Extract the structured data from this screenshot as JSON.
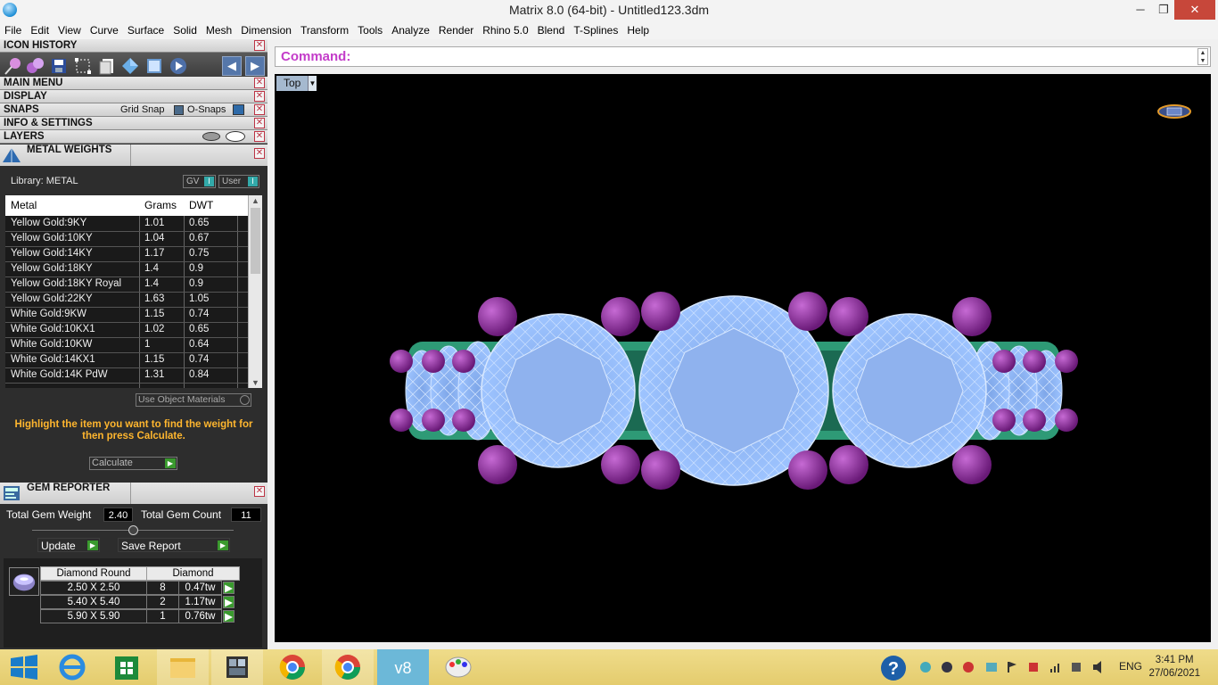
{
  "window": {
    "title": "Matrix 8.0 (64-bit) - Untitled123.3dm",
    "minimize": "─",
    "maximize": "❐",
    "close": "✕"
  },
  "menu": [
    "File",
    "Edit",
    "View",
    "Curve",
    "Surface",
    "Solid",
    "Mesh",
    "Dimension",
    "Transform",
    "Tools",
    "Analyze",
    "Render",
    "Rhino 5.0",
    "Blend",
    "T-Splines",
    "Help"
  ],
  "sections": {
    "icon_history": "ICON HISTORY",
    "main_menu": "MAIN MENU",
    "display": "DISPLAY",
    "snaps": "SNAPS",
    "grid_snap": "Grid Snap",
    "o_snaps": "O-Snaps",
    "info_settings": "INFO & SETTINGS",
    "layers": "LAYERS"
  },
  "metal_weights": {
    "title": "METAL WEIGHTS",
    "library": "Library: METAL",
    "gv_toggle": "GV",
    "user_toggle": "User",
    "columns": [
      "Metal",
      "Grams",
      "DWT"
    ],
    "rows": [
      [
        "Yellow Gold:9KY",
        "1.01",
        "0.65"
      ],
      [
        "Yellow Gold:10KY",
        "1.04",
        "0.67"
      ],
      [
        "Yellow Gold:14KY",
        "1.17",
        "0.75"
      ],
      [
        "Yellow Gold:18KY",
        "1.4",
        "0.9"
      ],
      [
        "Yellow Gold:18KY Royal",
        "1.4",
        "0.9"
      ],
      [
        "Yellow Gold:22KY",
        "1.63",
        "1.05"
      ],
      [
        "White Gold:9KW",
        "1.15",
        "0.74"
      ],
      [
        "White Gold:10KX1",
        "1.02",
        "0.65"
      ],
      [
        "White Gold:10KW",
        "1",
        "0.64"
      ],
      [
        "White Gold:14KX1",
        "1.15",
        "0.74"
      ],
      [
        "White Gold:14K PdW",
        "1.31",
        "0.84"
      ]
    ],
    "use_object_materials": "Use Object Materials",
    "hint": "Highlight the item you want to find the weight for then press Calculate.",
    "calculate": "Calculate"
  },
  "gem_reporter": {
    "title": "GEM REPORTER",
    "total_weight_label": "Total Gem Weight",
    "total_weight": "2.40",
    "total_count_label": "Total Gem Count",
    "total_count": "11",
    "update": "Update",
    "save_report": "Save Report",
    "head_shape": "Diamond Round",
    "head_material": "Diamond",
    "rows": [
      [
        "2.50 X 2.50",
        "8",
        "0.47tw"
      ],
      [
        "5.40 X 5.40",
        "2",
        "1.17tw"
      ],
      [
        "5.90 X 5.90",
        "1",
        "0.76tw"
      ]
    ]
  },
  "command": {
    "label": "Command:",
    "value": ""
  },
  "viewport": {
    "label": "Top"
  },
  "taskbar": {
    "lang": "ENG",
    "time": "3:41 PM",
    "date": "27/06/2021"
  },
  "colors": {
    "gem": "#9ec4ff",
    "prong": "#9a2fa6",
    "metal": "#2e9a76",
    "command": "#c33cc9",
    "hint": "#ffb62e"
  }
}
